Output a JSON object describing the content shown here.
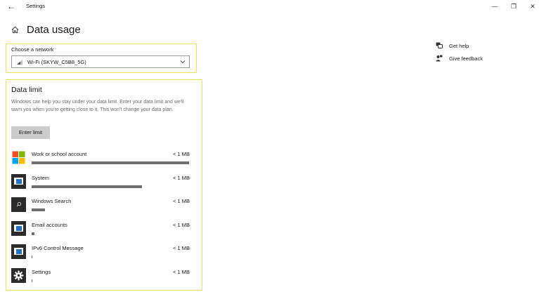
{
  "window": {
    "title": "Settings",
    "back_glyph": "←",
    "minimize_glyph": "—",
    "maximize_glyph": "❐",
    "close_glyph": "✕"
  },
  "page": {
    "title": "Data usage",
    "home_icon": "home-icon"
  },
  "network": {
    "label": "Choose a network",
    "selected": "Wi-Fi (SKYW_C5B8_5G)"
  },
  "data_limit": {
    "title": "Data limit",
    "description": "Windows can help you stay under your data limit. Enter your data limit and we'll warn you when you're getting close to it. This won't change your data plan.",
    "button_label": "Enter limit"
  },
  "apps": [
    {
      "name": "Work or school account",
      "usage": "< 1 MB",
      "fraction": 1.0,
      "icon": "windows-logo-icon"
    },
    {
      "name": "System",
      "usage": "< 1 MB",
      "fraction": 0.7,
      "icon": "system-window-icon"
    },
    {
      "name": "Windows Search",
      "usage": "< 1 MB",
      "fraction": 0.085,
      "icon": "search-icon"
    },
    {
      "name": "Email accounts",
      "usage": "< 1 MB",
      "fraction": 0.02,
      "icon": "email-window-icon"
    },
    {
      "name": "IPv6 Control Message",
      "usage": "< 1 MB",
      "fraction": 0.005,
      "icon": "ipv6-window-icon"
    },
    {
      "name": "Settings",
      "usage": "< 1 MB",
      "fraction": 0.005,
      "icon": "gear-icon"
    }
  ],
  "side_links": {
    "help": "Get help",
    "feedback": "Give feedback"
  },
  "colors": {
    "highlight_border": "#f2e25a",
    "bar": "#6e6e6e",
    "button_bg": "#cccccc",
    "icon_dark": "#2b2b2b",
    "icon_blue": "#1e73c8"
  }
}
